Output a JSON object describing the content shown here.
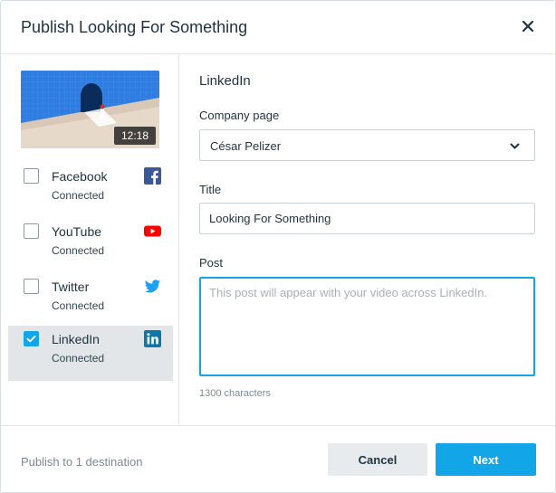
{
  "dialog": {
    "title": "Publish Looking For Something"
  },
  "video": {
    "duration": "12:18"
  },
  "destinations": [
    {
      "name": "Facebook",
      "status": "Connected",
      "icon": "facebook-icon",
      "checked": false
    },
    {
      "name": "YouTube",
      "status": "Connected",
      "icon": "youtube-icon",
      "checked": false
    },
    {
      "name": "Twitter",
      "status": "Connected",
      "icon": "twitter-icon",
      "checked": false
    },
    {
      "name": "LinkedIn",
      "status": "Connected",
      "icon": "linkedin-icon",
      "checked": true
    }
  ],
  "form": {
    "section_title": "LinkedIn",
    "company_label": "Company page",
    "company_value": "César Pelizer",
    "title_label": "Title",
    "title_value": "Looking For Something",
    "post_label": "Post",
    "post_placeholder": "This post will appear with your video across LinkedIn.",
    "char_count": "1300 characters"
  },
  "footer": {
    "status": "Publish to 1 destination",
    "cancel_label": "Cancel",
    "next_label": "Next"
  },
  "colors": {
    "accent": "#12a6e8",
    "facebook": "#3b5998",
    "youtube": "#ff0000",
    "twitter": "#1da1f2",
    "linkedin": "#0e76a8"
  }
}
